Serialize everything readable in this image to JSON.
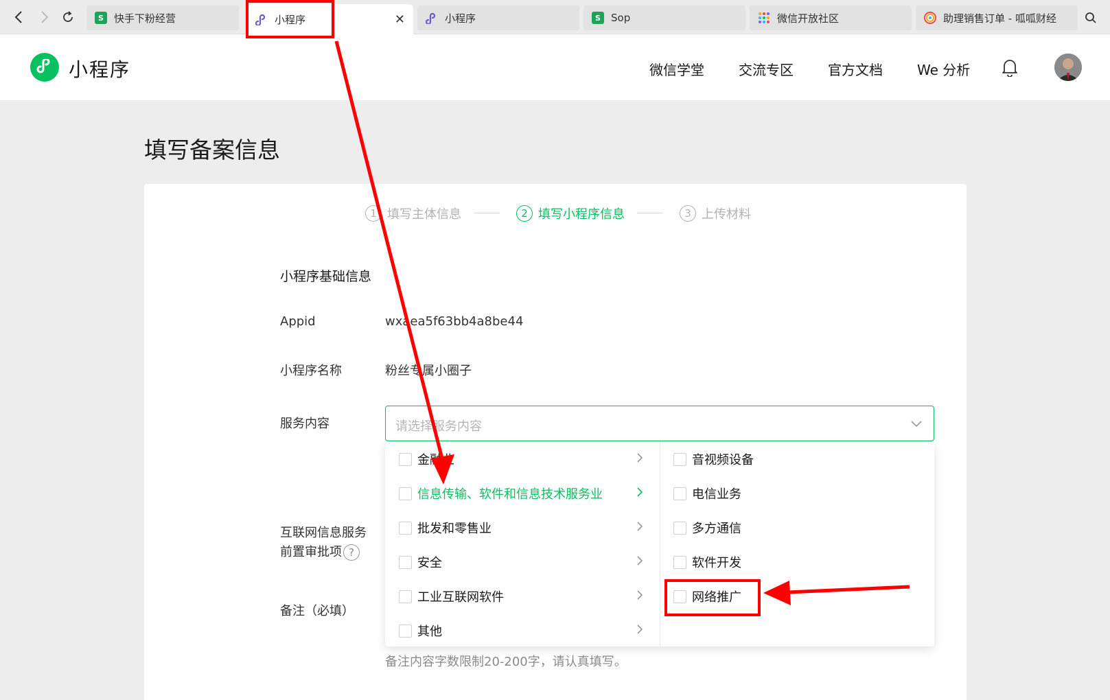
{
  "browser": {
    "tabs": [
      {
        "label": "快手下粉经营",
        "icon": "sheet-icon"
      },
      {
        "label": "小程序",
        "icon": "miniprogram-icon"
      },
      {
        "label": "小程序",
        "icon": "miniprogram-icon"
      },
      {
        "label": "Sop",
        "icon": "sheet-icon"
      },
      {
        "label": "微信开放社区",
        "icon": "community-icon"
      },
      {
        "label": "助理销售订单 - 呱呱财经",
        "icon": "rainbow-icon"
      }
    ],
    "sheet_letter": "S",
    "close_symbol": "✕"
  },
  "header": {
    "brand": "小程序",
    "nav": [
      "微信学堂",
      "交流专区",
      "官方文档",
      "We 分析"
    ]
  },
  "page": {
    "title": "填写备案信息",
    "steps": [
      {
        "num": "1",
        "label": "填写主体信息"
      },
      {
        "num": "2",
        "label": "填写小程序信息"
      },
      {
        "num": "3",
        "label": "上传材料"
      }
    ],
    "section_title": "小程序基础信息",
    "fields": {
      "appid_label": "Appid",
      "appid_value": "wxaea5f63bb4a8be44",
      "name_label": "小程序名称",
      "name_value": "粉丝专属小圈子",
      "service_label": "服务内容",
      "service_placeholder": "请选择服务内容",
      "internet_label_line1": "互联网信息服务",
      "internet_label_line2": "前置审批项",
      "help_symbol": "?",
      "remark_label": "备注（必填）",
      "remark_hint": "备注内容字数限制20-200字，请认真填写。"
    },
    "dropdown": {
      "left": [
        "金融业",
        "信息传输、软件和信息技术服务业",
        "批发和零售业",
        "安全",
        "工业互联网软件",
        "其他"
      ],
      "right": [
        "音视频设备",
        "电信业务",
        "多方通信",
        "软件开发",
        "网络推广"
      ],
      "arrow_symbol": "›"
    }
  },
  "colors": {
    "accent": "#07c160",
    "annotation": "#ff0000"
  }
}
